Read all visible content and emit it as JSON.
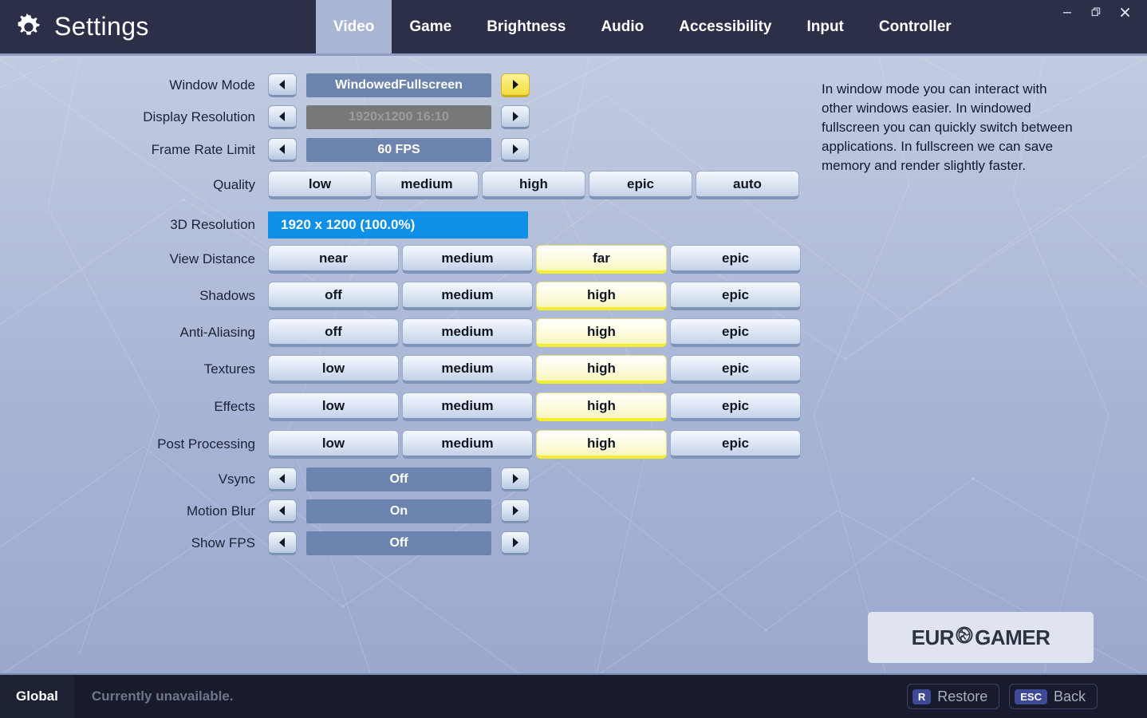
{
  "window": {
    "title": "Settings",
    "gear_icon": "gear-icon",
    "controls": [
      {
        "name": "minimize-button",
        "icon": "minimize-icon"
      },
      {
        "name": "restore-button",
        "icon": "restore-icon"
      },
      {
        "name": "close-button",
        "icon": "close-icon"
      }
    ]
  },
  "tabs": [
    {
      "label": "Video",
      "active": true
    },
    {
      "label": "Game",
      "active": false
    },
    {
      "label": "Brightness",
      "active": false
    },
    {
      "label": "Audio",
      "active": false
    },
    {
      "label": "Accessibility",
      "active": false
    },
    {
      "label": "Input",
      "active": false
    },
    {
      "label": "Controller",
      "active": false
    }
  ],
  "settings": {
    "window_mode": {
      "label": "Window Mode",
      "value": "WindowedFullscreen",
      "left_arrow": "◀",
      "right_arrow": "▶",
      "right_arrow_highlighted": true,
      "disabled": false
    },
    "display_resolution": {
      "label": "Display Resolution",
      "value": "1920x1200 16:10",
      "left_arrow": "◀",
      "right_arrow": "▶",
      "right_arrow_highlighted": false,
      "disabled": true
    },
    "frame_rate_limit": {
      "label": "Frame Rate Limit",
      "value": "60 FPS",
      "left_arrow": "◀",
      "right_arrow": "▶",
      "right_arrow_highlighted": false,
      "disabled": false
    },
    "quality": {
      "label": "Quality",
      "options": [
        "low",
        "medium",
        "high",
        "epic",
        "auto"
      ],
      "selected": -1
    },
    "resolution_3d": {
      "label": "3D Resolution",
      "value": "1920 x 1200 (100.0%)",
      "fill_percent": 100,
      "fill_color": "#0e8fe8"
    },
    "view_distance": {
      "label": "View Distance",
      "options": [
        "near",
        "medium",
        "far",
        "epic"
      ],
      "selected": 2
    },
    "shadows": {
      "label": "Shadows",
      "options": [
        "off",
        "medium",
        "high",
        "epic"
      ],
      "selected": 2
    },
    "anti_aliasing": {
      "label": "Anti-Aliasing",
      "options": [
        "off",
        "medium",
        "high",
        "epic"
      ],
      "selected": 2
    },
    "textures": {
      "label": "Textures",
      "options": [
        "low",
        "medium",
        "high",
        "epic"
      ],
      "selected": 2
    },
    "effects": {
      "label": "Effects",
      "options": [
        "low",
        "medium",
        "high",
        "epic"
      ],
      "selected": 2
    },
    "post_processing": {
      "label": "Post Processing",
      "options": [
        "low",
        "medium",
        "high",
        "epic"
      ],
      "selected": 2
    },
    "vsync": {
      "label": "Vsync",
      "value": "Off",
      "left_arrow": "◀",
      "right_arrow": "▶",
      "right_arrow_highlighted": false,
      "disabled": false
    },
    "motion_blur": {
      "label": "Motion Blur",
      "value": "On",
      "left_arrow": "◀",
      "right_arrow": "▶",
      "right_arrow_highlighted": false,
      "disabled": false
    },
    "show_fps": {
      "label": "Show FPS",
      "value": "Off",
      "left_arrow": "◀",
      "right_arrow": "▶",
      "right_arrow_highlighted": false,
      "disabled": false
    }
  },
  "description": "In window mode you can interact with other windows easier. In windowed fullscreen you can quickly switch between applications. In fullscreen we can save memory and render slightly faster.",
  "watermark": {
    "text_left": "EUR",
    "text_right": "GAMER",
    "globe_icon": "globe-icon"
  },
  "footer": {
    "scope": "Global",
    "status": "Currently unavailable.",
    "restore": {
      "key": "R",
      "label": "Restore"
    },
    "back": {
      "key": "ESC",
      "label": "Back"
    }
  },
  "colors": {
    "accent_yellow": "#f4ef2e",
    "slider_blue": "#0e8fe8",
    "header_dark": "#2b2f47",
    "footer_dark": "#171b2d",
    "spinner_blue": "#6c84ae"
  }
}
